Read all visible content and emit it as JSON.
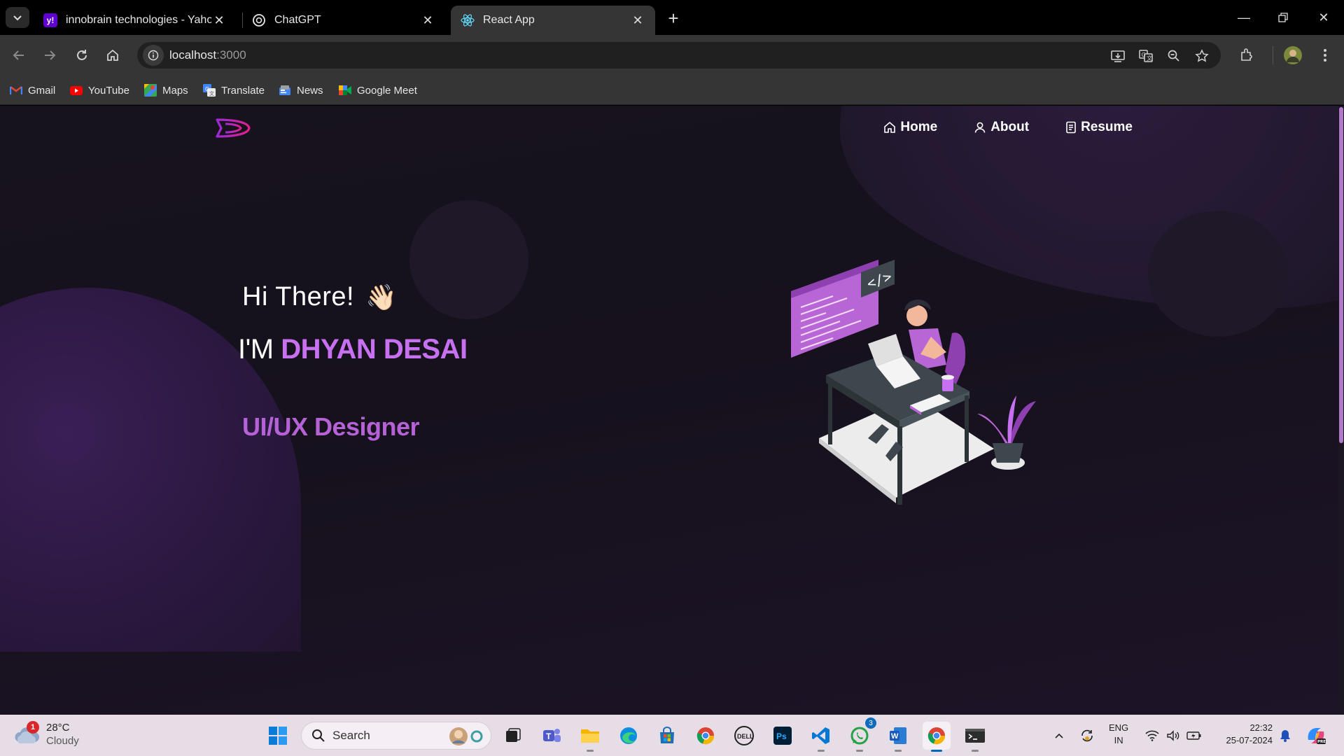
{
  "browser": {
    "tabs": [
      {
        "title": "innobrain technologies - Yahoo",
        "favicon": "yahoo-icon",
        "active": false
      },
      {
        "title": "ChatGPT",
        "favicon": "chatgpt-icon",
        "active": false
      },
      {
        "title": "React App",
        "favicon": "react-icon",
        "active": true
      }
    ],
    "url_host": "localhost",
    "url_port": ":3000",
    "bookmarks": [
      {
        "label": "Gmail",
        "icon": "gmail-icon"
      },
      {
        "label": "YouTube",
        "icon": "youtube-icon"
      },
      {
        "label": "Maps",
        "icon": "maps-icon"
      },
      {
        "label": "Translate",
        "icon": "translate-icon"
      },
      {
        "label": "News",
        "icon": "news-icon"
      },
      {
        "label": "Google Meet",
        "icon": "google-meet-icon"
      }
    ]
  },
  "site": {
    "nav": [
      {
        "label": "Home",
        "icon": "home-icon"
      },
      {
        "label": "About",
        "icon": "user-icon"
      },
      {
        "label": "Resume",
        "icon": "document-icon"
      }
    ],
    "hero": {
      "greeting": "Hi There!",
      "wave": "👋🏻",
      "im_prefix": "I'M ",
      "name": "DHYAN DESAI",
      "role": "UI/UX Designer"
    },
    "colors": {
      "accent": "#c770f0",
      "role": "#b562d6",
      "background": "#17131d"
    }
  },
  "taskbar": {
    "weather": {
      "temp": "28°C",
      "condition": "Cloudy",
      "badge": "1"
    },
    "search_label": "Search",
    "whatsapp_badge": "3",
    "language": {
      "line1": "ENG",
      "line2": "IN"
    },
    "time": "22:32",
    "date": "25-07-2024"
  }
}
